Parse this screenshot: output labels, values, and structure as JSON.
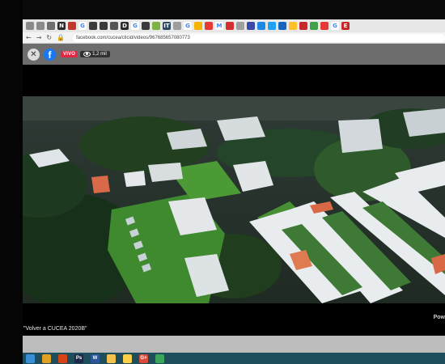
{
  "browser": {
    "url": "facebook.com/cucea/clicid/videos/967685657080773",
    "bookmarks": [
      {
        "icon": "bookmark-icon",
        "label": "",
        "color": "#8a8a8a"
      },
      {
        "icon": "bookmark-icon",
        "label": "",
        "color": "#8a8a8a"
      },
      {
        "icon": "bookmark-icon",
        "label": "",
        "color": "#6e6e6e"
      },
      {
        "icon": "bookmark-icon",
        "label": "N",
        "color": "#2b2b2b"
      },
      {
        "icon": "bookmark-icon",
        "label": "",
        "color": "#c0392b"
      },
      {
        "icon": "bookmark-icon",
        "label": "G",
        "color": "#ffffff"
      },
      {
        "icon": "bookmark-icon",
        "label": "",
        "color": "#3a3a3a"
      },
      {
        "icon": "bookmark-icon",
        "label": "",
        "color": "#3a3a3a"
      },
      {
        "icon": "bookmark-icon",
        "label": "",
        "color": "#555555"
      },
      {
        "icon": "bookmark-icon",
        "label": "D",
        "color": "#2b2b2b"
      },
      {
        "icon": "bookmark-icon",
        "label": "G",
        "color": "#ffffff"
      },
      {
        "icon": "bookmark-icon",
        "label": "",
        "color": "#3a3a3a"
      },
      {
        "icon": "bookmark-icon",
        "label": "",
        "color": "#7cb342"
      },
      {
        "icon": "bookmark-icon",
        "label": "IT",
        "color": "#2e4a62"
      },
      {
        "icon": "bookmark-icon",
        "label": "",
        "color": "#9e9e9e"
      },
      {
        "icon": "bookmark-icon",
        "label": "G",
        "color": "#ffffff"
      },
      {
        "icon": "bookmark-icon",
        "label": "",
        "color": "#f4b400"
      },
      {
        "icon": "bookmark-icon",
        "label": "",
        "color": "#e53935"
      },
      {
        "icon": "bookmark-icon",
        "label": "M",
        "color": "#ffffff"
      },
      {
        "icon": "bookmark-icon",
        "label": "",
        "color": "#d32f2f"
      },
      {
        "icon": "bookmark-icon",
        "label": "",
        "color": "#9e9e9e"
      },
      {
        "icon": "bookmark-icon",
        "label": "",
        "color": "#3949ab"
      },
      {
        "icon": "bookmark-icon",
        "label": "",
        "color": "#1e88e5"
      },
      {
        "icon": "bookmark-icon",
        "label": "",
        "color": "#1da1f2"
      },
      {
        "icon": "bookmark-icon",
        "label": "",
        "color": "#1565c0"
      },
      {
        "icon": "bookmark-icon",
        "label": "",
        "color": "#fbc02d"
      },
      {
        "icon": "bookmark-icon",
        "label": "",
        "color": "#c62828"
      },
      {
        "icon": "bookmark-icon",
        "label": "",
        "color": "#43a047"
      },
      {
        "icon": "bookmark-icon",
        "label": "",
        "color": "#e53935"
      },
      {
        "icon": "bookmark-icon",
        "label": "G",
        "color": "#ffffff"
      },
      {
        "icon": "bookmark-icon",
        "label": "E",
        "color": "#c62828"
      }
    ]
  },
  "player": {
    "live_label": "VIVO",
    "viewers": "1,2 mil",
    "powered_label": "Pow",
    "caption": "\"Volver a CUCEA 2020B\""
  },
  "colors": {
    "facebook_blue": "#1877f2",
    "live_red": "#e42645",
    "taskbar": "#1e4d5c"
  },
  "taskbar": {
    "apps": [
      {
        "icon": "windows-start-icon",
        "label": "",
        "color": "#3a8fd6"
      },
      {
        "icon": "chrome-icon",
        "label": "",
        "color": "#e0a020"
      },
      {
        "icon": "app-icon",
        "label": "",
        "color": "#d84315"
      },
      {
        "icon": "photoshop-icon",
        "label": "Ps",
        "color": "#1b2a48"
      },
      {
        "icon": "word-icon",
        "label": "W",
        "color": "#2b579a"
      },
      {
        "icon": "folder-icon",
        "label": "",
        "color": "#f2c14e"
      },
      {
        "icon": "explorer-icon",
        "label": "",
        "color": "#fbd048"
      },
      {
        "icon": "google-plus-icon",
        "label": "G+",
        "color": "#dd4b39"
      },
      {
        "icon": "app-icon",
        "label": "",
        "color": "#3ba55c"
      }
    ]
  }
}
